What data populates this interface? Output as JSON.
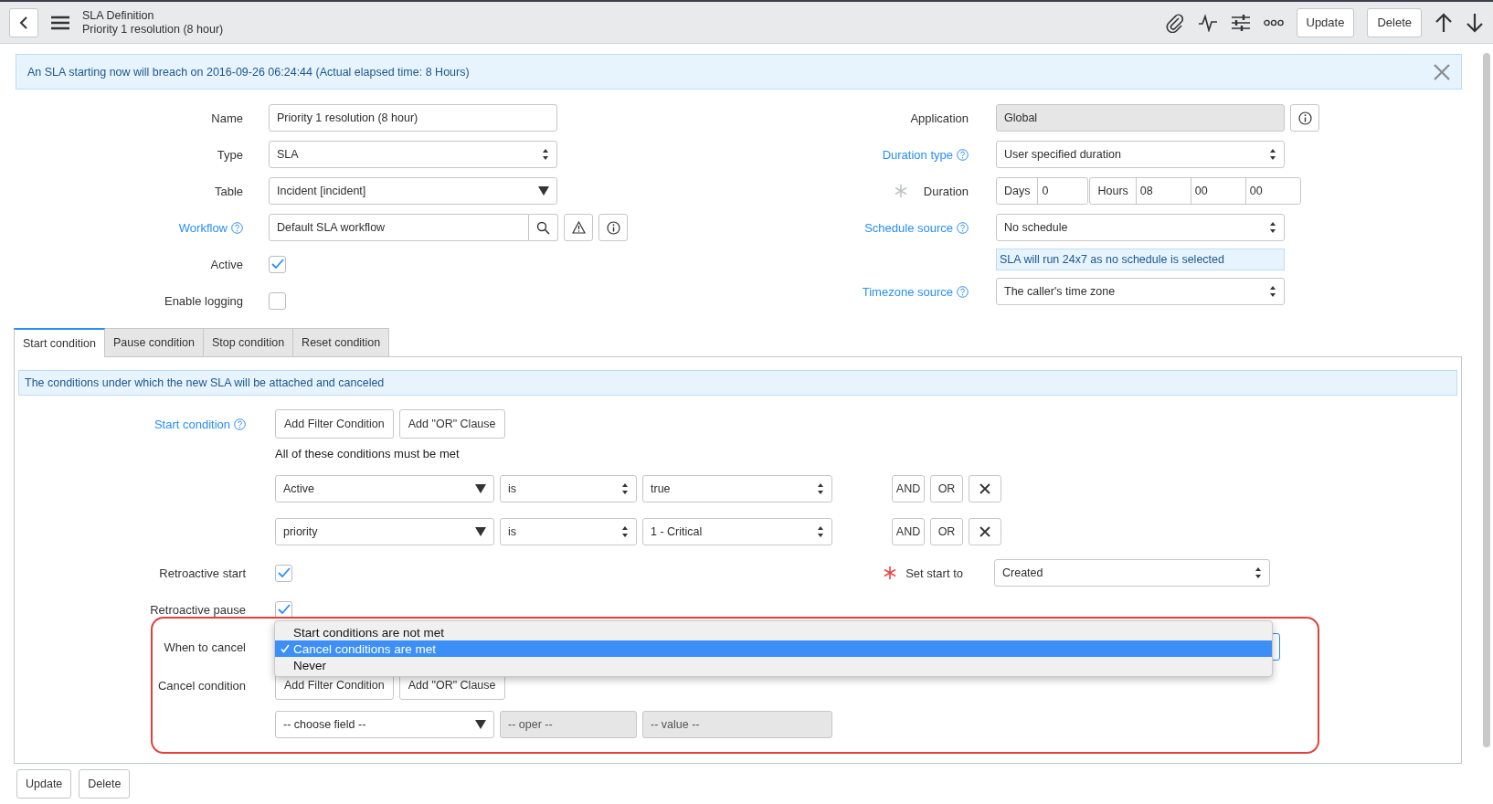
{
  "header": {
    "title": "SLA Definition",
    "subtitle": "Priority 1 resolution (8 hour)",
    "buttons": [
      "Update",
      "Delete"
    ]
  },
  "banner": {
    "text": "An SLA starting now will breach on 2016-09-26 06:24:44 (Actual elapsed time: 8 Hours)"
  },
  "form_left": [
    {
      "label": "Name",
      "kind": "text",
      "value": "Priority 1 resolution (8 hour)",
      "help": false
    },
    {
      "label": "Type",
      "kind": "select",
      "value": "SLA",
      "help": false
    },
    {
      "label": "Table",
      "kind": "dropdown",
      "value": "Incident [incident]",
      "help": false
    },
    {
      "label": "Workflow",
      "kind": "reference",
      "value": "Default SLA workflow",
      "help": true
    },
    {
      "label": "Active",
      "kind": "checkbox",
      "checked": true,
      "help": false
    },
    {
      "label": "Enable logging",
      "kind": "checkbox",
      "checked": false,
      "help": false
    }
  ],
  "form_right": [
    {
      "label": "Application",
      "kind": "readonly",
      "value": "Global",
      "help": false
    },
    {
      "label": "Duration type",
      "kind": "select",
      "value": "User specified duration",
      "help": true
    },
    {
      "label": "Duration",
      "kind": "duration",
      "required": true,
      "required_highlight": false,
      "help": false,
      "days_label": "Days",
      "days": "0",
      "hours_label": "Hours",
      "hours": "08",
      "minutes": "00",
      "seconds": "00"
    },
    {
      "label": "Schedule source",
      "kind": "select",
      "value": "No schedule",
      "help": true,
      "note": "SLA will run 24x7 as no schedule is selected"
    },
    {
      "label": "Timezone source",
      "kind": "select",
      "value": "The caller's time zone",
      "help": true
    }
  ],
  "tabs": [
    {
      "label": "Start condition",
      "selected": true
    },
    {
      "label": "Pause condition",
      "selected": false
    },
    {
      "label": "Stop condition",
      "selected": false
    },
    {
      "label": "Reset condition",
      "selected": false
    }
  ],
  "tab_panel": {
    "info": "The conditions under which the new SLA will be attached and canceled",
    "start_condition": {
      "label": "Start condition",
      "help": true,
      "buttons": [
        "Add Filter Condition",
        "Add \"OR\" Clause"
      ],
      "summary": "All of these conditions must be met",
      "rows": [
        {
          "field": "Active",
          "operator": "is",
          "value": "true",
          "and": "AND",
          "or": "OR"
        },
        {
          "field": "priority",
          "operator": "is",
          "value": "1 - Critical",
          "and": "AND",
          "or": "OR"
        }
      ]
    },
    "retroactive_start": {
      "label": "Retroactive start",
      "checked": true
    },
    "set_start_to": {
      "label": "Set start to",
      "value": "Created",
      "required_highlight": true
    },
    "retroactive_pause": {
      "label": "Retroactive pause",
      "checked": true
    },
    "when_to_cancel": {
      "label": "When to cancel",
      "options": [
        {
          "label": "Start conditions are not met",
          "selected": false
        },
        {
          "label": "Cancel conditions are met",
          "selected": true
        },
        {
          "label": "Never",
          "selected": false
        }
      ]
    },
    "cancel_condition": {
      "label": "Cancel condition",
      "buttons": [
        "Add Filter Condition",
        "Add \"OR\" Clause"
      ],
      "field": "-- choose field --",
      "operator": "-- oper --",
      "value": "-- value --"
    }
  },
  "footer_buttons": [
    "Update",
    "Delete"
  ]
}
